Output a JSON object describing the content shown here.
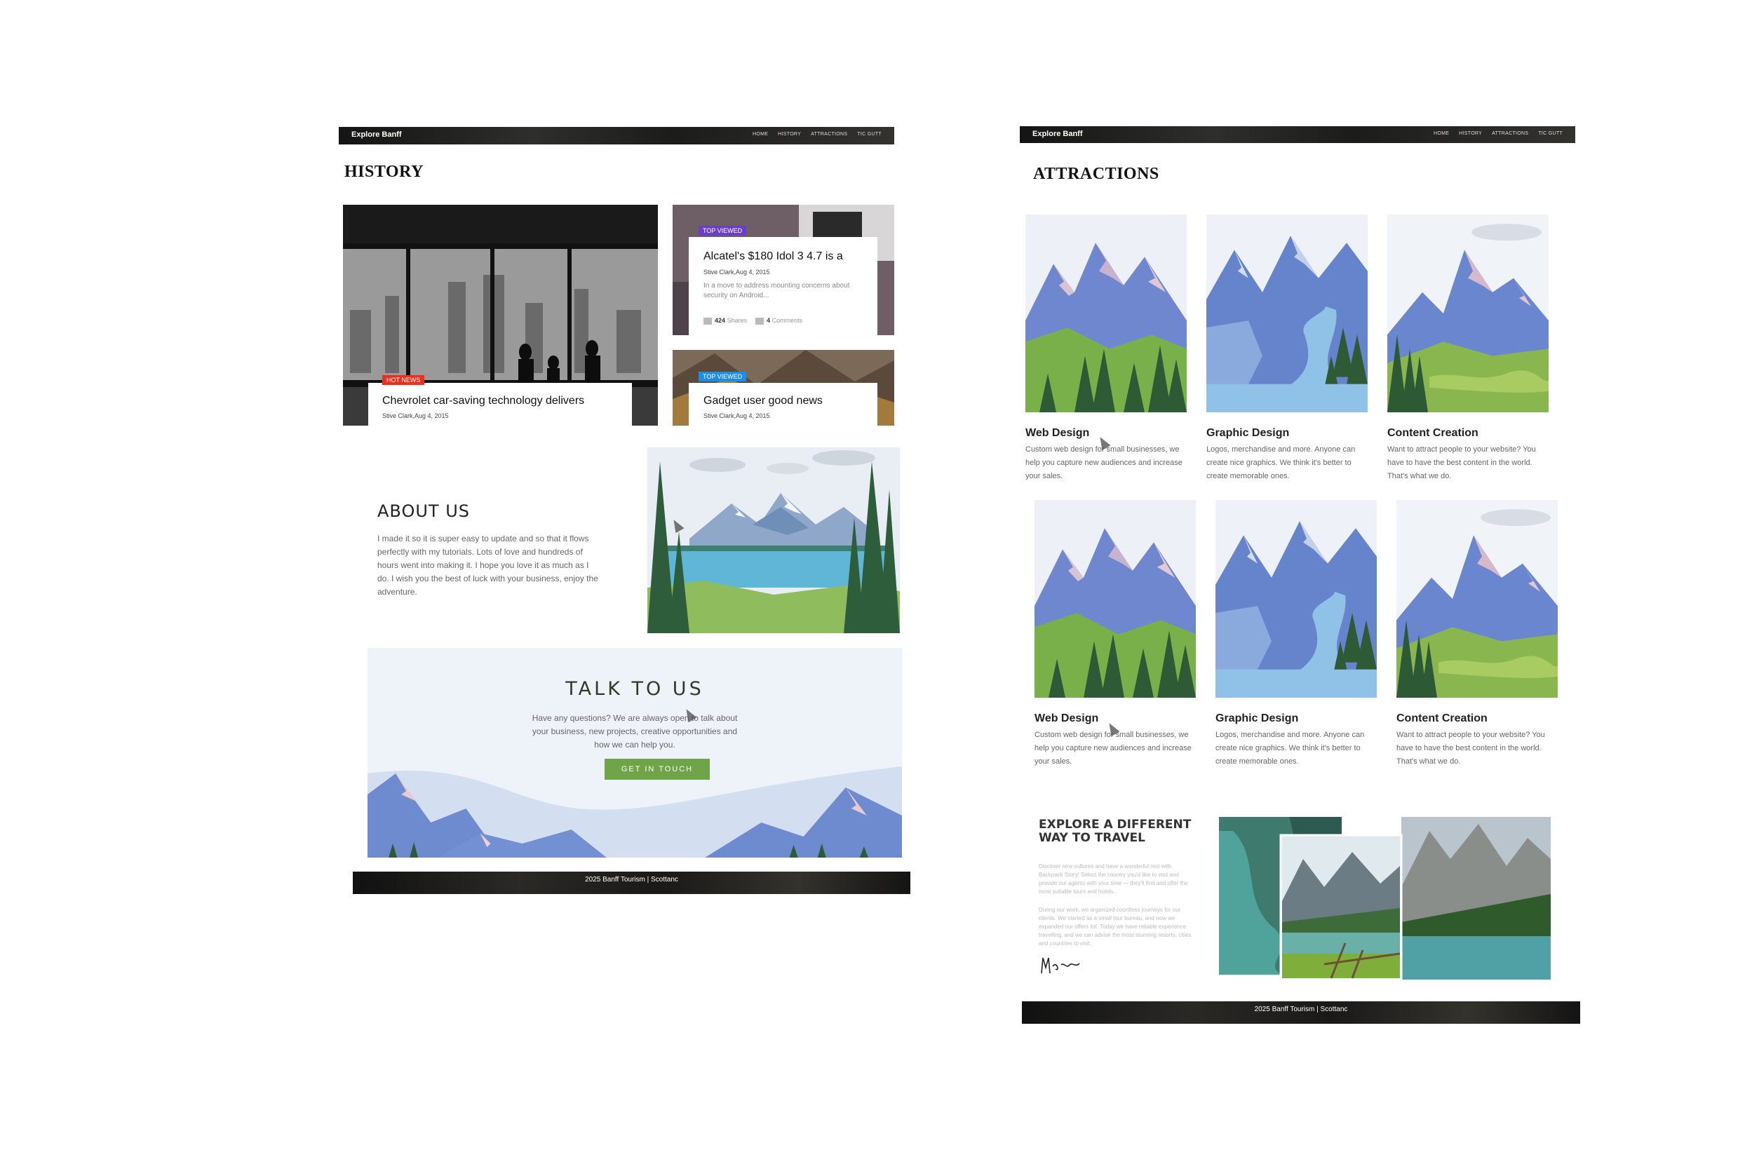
{
  "left": {
    "nav": {
      "brand": "Explore Banff",
      "links": [
        "Home",
        "History",
        "Attractions",
        "Tic Gutt"
      ]
    },
    "page_title": "HISTORY",
    "news": [
      {
        "badge": "HOT NEWS",
        "badge_color": "#e8301c",
        "title": "Chevrolet car-saving technology delivers",
        "meta": "Stive Clark,Aug 4, 2015"
      },
      {
        "badge": "TOP VIEWED",
        "badge_color": "#6a3fc6",
        "title": "Alcatel's $180 Idol 3 4.7 is a",
        "meta": "Stive Clark,Aug 4, 2015",
        "excerpt": "In a move to address mounting concerns about security on Android...",
        "shares_count": "424",
        "shares_label": "Shares",
        "comments_count": "4",
        "comments_label": "Comments"
      },
      {
        "badge": "TOP VIEWED",
        "badge_color": "#1f8ce6",
        "title": "Gadget user good news",
        "meta": "Stive Clark,Aug 4, 2015"
      }
    ],
    "about": {
      "title": "ABOUT US",
      "text": "I made it so it is super easy to update and so that it flows perfectly with my tutorials. Lots of love and hundreds of hours went into making it. I hope you love it as much as I do. I wish you the best of luck with your business, enjoy the adventure."
    },
    "talk": {
      "title": "TALK TO US",
      "text": "Have any questions? We are always open to talk about your business, new projects, creative opportunities and how we can help you.",
      "button": "GET IN TOUCH"
    },
    "footer": "2025 Banff Tourism | Scottanc"
  },
  "right": {
    "nav": {
      "brand": "Explore Banff",
      "links": [
        "Home",
        "History",
        "Attractions",
        "Tic Gutt"
      ]
    },
    "page_title": "ATTRACTIONS",
    "services": [
      {
        "title": "Web Design",
        "text": "Custom web design for small businesses, we help you capture new audiences and increase your sales."
      },
      {
        "title": "Graphic Design",
        "text": "Logos, merchandise and more. Anyone can create nice graphics. We think it's better to create memorable ones."
      },
      {
        "title": "Content Creation",
        "text": "Want to attract people to your website? You have to have the best content in the world. That's what we do."
      },
      {
        "title": "Web Design",
        "text": "Custom web design for small businesses, we help you capture new audiences and increase your sales."
      },
      {
        "title": "Graphic Design",
        "text": "Logos, merchandise and more. Anyone can create nice graphics. We think it's better to create memorable ones."
      },
      {
        "title": "Content Creation",
        "text": "Want to attract people to your website? You have to have the best content in the world. That's what we do."
      }
    ],
    "explore": {
      "title_line1": "EXPLORE A DIFFERENT",
      "title_line2": "WAY TO TRAVEL",
      "para1": "Discover new cultures and have a wonderful rest with Backpack Story! Select the country you'd like to visit and provide our agents with your time — they'll find and offer the most suitable tours and hotels.",
      "para2": "During our work, we organized countless journeys for our clients. We started as a small tour bureau, and now we expanded our offers list. Today we have reliable experience travelling, and we can advise the most stunning resorts, cities and countries to visit.",
      "signature": "Megan Smith"
    },
    "footer": "2025 Banff Tourism | Scottanc"
  }
}
